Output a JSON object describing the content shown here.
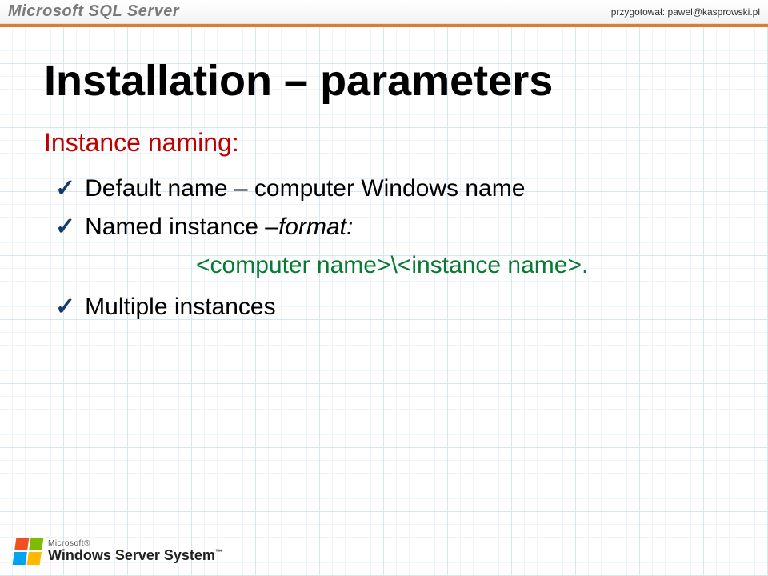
{
  "header": {
    "product": "Microsoft SQL Server",
    "author_prefix": "przygotował: ",
    "author_email": "pawel@kasprowski.pl"
  },
  "slide": {
    "title": "Installation – parameters",
    "subtitle": "Instance naming:",
    "bullets": {
      "b1": "Default name – computer Windows name",
      "b2_lead": "Named instance –",
      "b2_tail": "format:",
      "b2_format": "<computer name>\\<instance name>.",
      "b3": "Multiple instances"
    }
  },
  "footer": {
    "ms": "Microsoft®",
    "product": "Windows Server System",
    "tm": "™"
  }
}
